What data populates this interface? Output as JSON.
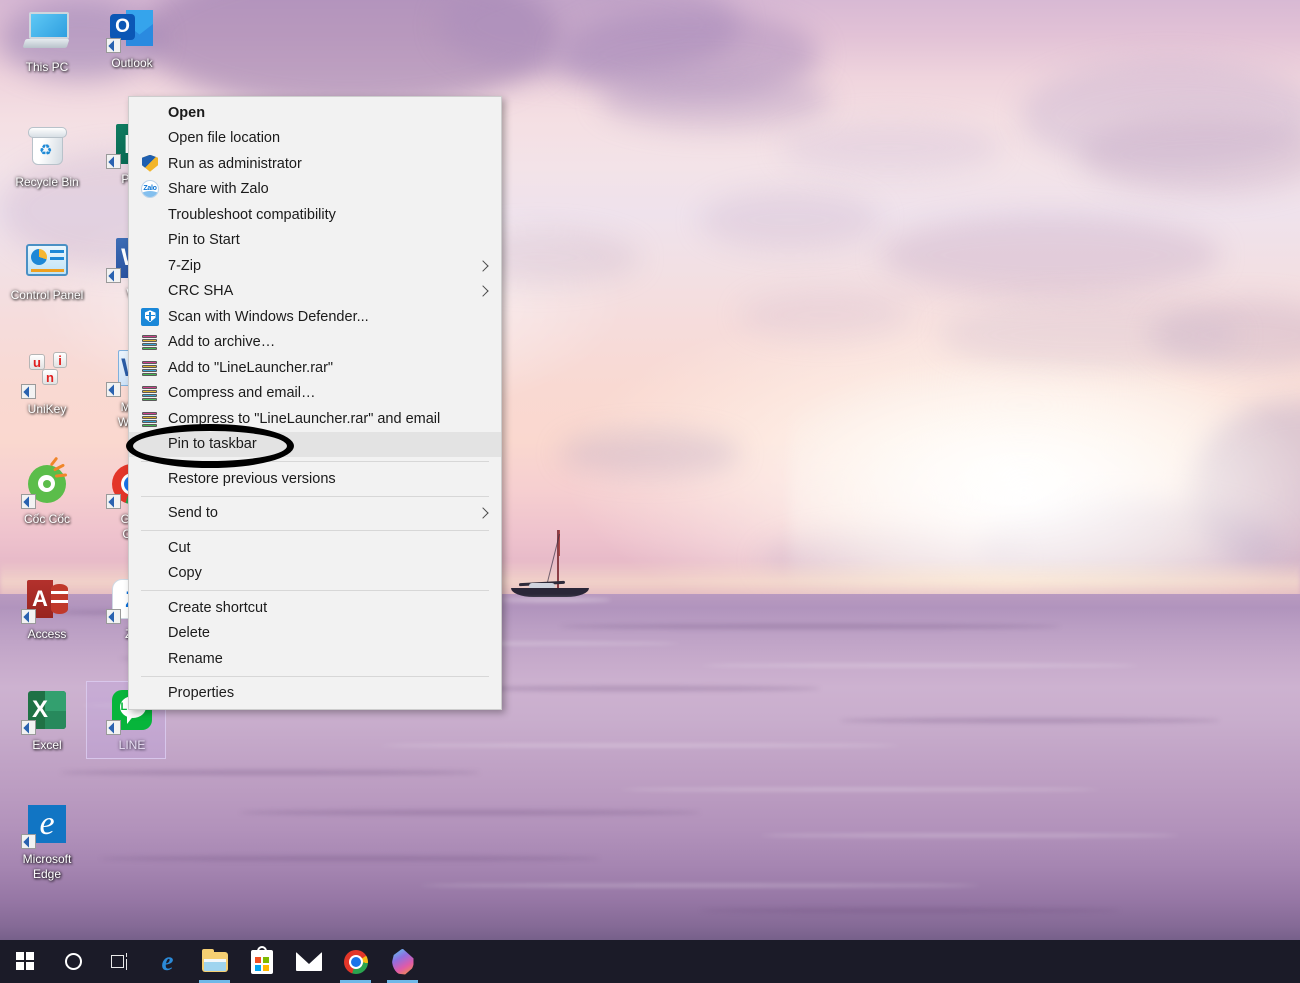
{
  "desktop": {
    "icons": [
      {
        "name": "this-pc",
        "label": "This PC",
        "shortcut": false,
        "selected": false
      },
      {
        "name": "outlook",
        "label": "Outlook",
        "shortcut": true,
        "selected": false
      },
      {
        "name": "recycle-bin",
        "label": "Recycle Bin",
        "shortcut": false,
        "selected": false
      },
      {
        "name": "publisher",
        "label": "Pub",
        "shortcut": true,
        "selected": false
      },
      {
        "name": "control-panel",
        "label": "Control Panel",
        "shortcut": false,
        "selected": false
      },
      {
        "name": "word",
        "label": "W",
        "shortcut": true,
        "selected": false
      },
      {
        "name": "unikey",
        "label": "UniKey",
        "shortcut": true,
        "selected": false
      },
      {
        "name": "microsoft-word",
        "label": "Micr\nWord",
        "shortcut": true,
        "selected": false
      },
      {
        "name": "coc-coc",
        "label": "Cốc Cốc",
        "shortcut": true,
        "selected": false
      },
      {
        "name": "google-chrome",
        "label": "Goo\nChr",
        "shortcut": true,
        "selected": false
      },
      {
        "name": "access",
        "label": "Access",
        "shortcut": true,
        "selected": false
      },
      {
        "name": "zalo",
        "label": "Za",
        "shortcut": true,
        "selected": false
      },
      {
        "name": "excel",
        "label": "Excel",
        "shortcut": true,
        "selected": false
      },
      {
        "name": "line",
        "label": "LINE",
        "shortcut": true,
        "selected": true
      },
      {
        "name": "microsoft-edge",
        "label": "Microsoft\nEdge",
        "shortcut": true,
        "selected": false
      }
    ],
    "icon_labels": {
      "this_pc": "This PC",
      "outlook": "Outlook",
      "recycle_bin": "Recycle Bin",
      "publisher": "Pub",
      "control_panel": "Control Panel",
      "word": "W",
      "unikey": "UniKey",
      "microsoft_word_line1": "Micr",
      "microsoft_word_line2": "Word",
      "coc_coc": "Cốc Cốc",
      "chrome_line1": "Goo",
      "chrome_line2": "Chr",
      "access": "Access",
      "zalo": "Za",
      "excel": "Excel",
      "line_app": "LINE",
      "edge_line1": "Microsoft",
      "edge_line2": "Edge"
    }
  },
  "context_menu": {
    "target_file": "LineLauncher.rar",
    "highlighted_item": "Pin to taskbar",
    "items": [
      {
        "label": "Open",
        "icon": "none",
        "bold": true,
        "submenu": false,
        "highlight": false,
        "separator_after": false
      },
      {
        "label": "Open file location",
        "icon": "none",
        "bold": false,
        "submenu": false,
        "highlight": false,
        "separator_after": false
      },
      {
        "label": "Run as administrator",
        "icon": "uac-shield-icon",
        "bold": false,
        "submenu": false,
        "highlight": false,
        "separator_after": false
      },
      {
        "label": "Share with Zalo",
        "icon": "zalo-icon",
        "bold": false,
        "submenu": false,
        "highlight": false,
        "separator_after": false
      },
      {
        "label": "Troubleshoot compatibility",
        "icon": "none",
        "bold": false,
        "submenu": false,
        "highlight": false,
        "separator_after": false
      },
      {
        "label": "Pin to Start",
        "icon": "none",
        "bold": false,
        "submenu": false,
        "highlight": false,
        "separator_after": false
      },
      {
        "label": "7-Zip",
        "icon": "none",
        "bold": false,
        "submenu": true,
        "highlight": false,
        "separator_after": false
      },
      {
        "label": "CRC SHA",
        "icon": "none",
        "bold": false,
        "submenu": true,
        "highlight": false,
        "separator_after": false
      },
      {
        "label": "Scan with Windows Defender...",
        "icon": "windows-defender-icon",
        "bold": false,
        "submenu": false,
        "highlight": false,
        "separator_after": false
      },
      {
        "label": "Add to archive…",
        "icon": "winrar-icon",
        "bold": false,
        "submenu": false,
        "highlight": false,
        "separator_after": false
      },
      {
        "label": "Add to \"LineLauncher.rar\"",
        "icon": "winrar-icon",
        "bold": false,
        "submenu": false,
        "highlight": false,
        "separator_after": false
      },
      {
        "label": "Compress and email…",
        "icon": "winrar-icon",
        "bold": false,
        "submenu": false,
        "highlight": false,
        "separator_after": false
      },
      {
        "label": "Compress to \"LineLauncher.rar\" and email",
        "icon": "winrar-icon",
        "bold": false,
        "submenu": false,
        "highlight": false,
        "separator_after": false
      },
      {
        "label": "Pin to taskbar",
        "icon": "none",
        "bold": false,
        "submenu": false,
        "highlight": true,
        "separator_after": true
      },
      {
        "label": "Restore previous versions",
        "icon": "none",
        "bold": false,
        "submenu": false,
        "highlight": false,
        "separator_after": true
      },
      {
        "label": "Send to",
        "icon": "none",
        "bold": false,
        "submenu": true,
        "highlight": false,
        "separator_after": true
      },
      {
        "label": "Cut",
        "icon": "none",
        "bold": false,
        "submenu": false,
        "highlight": false,
        "separator_after": false
      },
      {
        "label": "Copy",
        "icon": "none",
        "bold": false,
        "submenu": false,
        "highlight": false,
        "separator_after": true
      },
      {
        "label": "Create shortcut",
        "icon": "none",
        "bold": false,
        "submenu": false,
        "highlight": false,
        "separator_after": false
      },
      {
        "label": "Delete",
        "icon": "none",
        "bold": false,
        "submenu": false,
        "highlight": false,
        "separator_after": false
      },
      {
        "label": "Rename",
        "icon": "none",
        "bold": false,
        "submenu": false,
        "highlight": false,
        "separator_after": true
      },
      {
        "label": "Properties",
        "icon": "none",
        "bold": false,
        "submenu": false,
        "highlight": false,
        "separator_after": false
      }
    ]
  },
  "annotation": {
    "type": "ellipse-highlight",
    "color": "#000000",
    "targets_label": "Pin to taskbar"
  },
  "taskbar": {
    "background_color": "#1b1b28",
    "items": [
      {
        "name": "start-button",
        "icon": "windows-logo-icon",
        "running": false
      },
      {
        "name": "cortana-search",
        "icon": "cortana-circle-icon",
        "running": false
      },
      {
        "name": "task-view",
        "icon": "task-view-icon",
        "running": false
      },
      {
        "name": "microsoft-edge",
        "icon": "edge-icon",
        "running": false
      },
      {
        "name": "file-explorer",
        "icon": "folder-icon",
        "running": true
      },
      {
        "name": "microsoft-store",
        "icon": "store-bag-icon",
        "running": false
      },
      {
        "name": "mail",
        "icon": "mail-envelope-icon",
        "running": false
      },
      {
        "name": "google-chrome",
        "icon": "chrome-icon",
        "running": true
      },
      {
        "name": "coc-coc",
        "icon": "coccoc-drop-icon",
        "running": true
      }
    ]
  },
  "wallpaper": {
    "scene": "pastel sunset sky over ocean with sailboat",
    "sky_top_color": "#d8b9d4",
    "sky_bottom_color": "#f9d9d2",
    "sea_color": "#bb9fc4"
  }
}
